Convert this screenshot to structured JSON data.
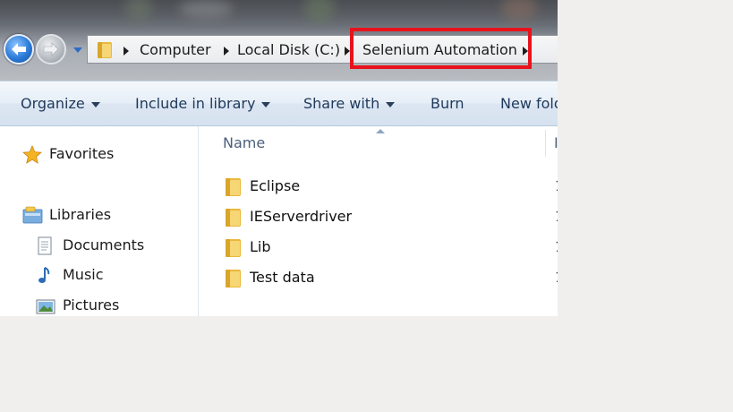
{
  "window": {
    "breadcrumb": [
      {
        "label": "Computer"
      },
      {
        "label": "Local Disk (C:)"
      },
      {
        "label": "Selenium Automation"
      }
    ]
  },
  "toolbar": {
    "organize": "Organize",
    "include_in_library": "Include in library",
    "share_with": "Share with",
    "burn": "Burn",
    "new_folder": "New fold"
  },
  "navigation": {
    "favorites": "Favorites",
    "libraries": "Libraries",
    "documents": "Documents",
    "music": "Music",
    "pictures": "Pictures"
  },
  "filelist": {
    "column_name": "Name",
    "column_next_partial": "I",
    "rows": [
      {
        "name": "Eclipse",
        "partial": "1"
      },
      {
        "name": "IEServerdriver",
        "partial": "1"
      },
      {
        "name": "Lib",
        "partial": "1"
      },
      {
        "name": "Test data",
        "partial": "1"
      }
    ]
  },
  "colors": {
    "highlight_border": "#e8121c",
    "toolbar_text": "#1e395b",
    "folder_yellow": "#f1c453"
  }
}
